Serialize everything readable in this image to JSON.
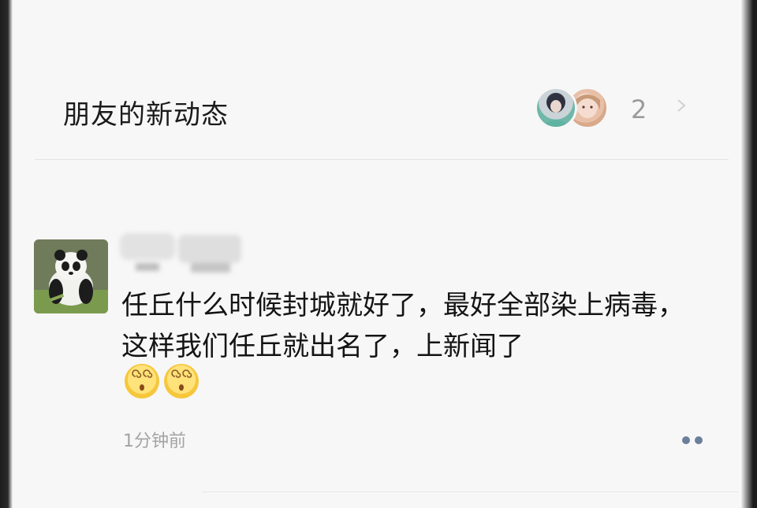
{
  "header": {
    "title": "朋友的新动态",
    "count": "2",
    "avatars": [
      "friend-avatar-1",
      "friend-avatar-2"
    ],
    "chevron_icon": "chevron-right-icon"
  },
  "post": {
    "avatar_icon": "panda-avatar",
    "text": "任丘什么时候封城就好了，最好全部染上病毒，这样我们任丘就出名了，上新闻了",
    "emojis": [
      "dizzy-face-emoji",
      "dizzy-face-emoji"
    ],
    "time": "1分钟前",
    "more_icon": "more-dots-icon"
  },
  "colors": {
    "card_bg": "#f7f7f7",
    "text_primary": "#141414",
    "text_secondary": "#a3a3a3",
    "divider": "#e4e4e4"
  }
}
